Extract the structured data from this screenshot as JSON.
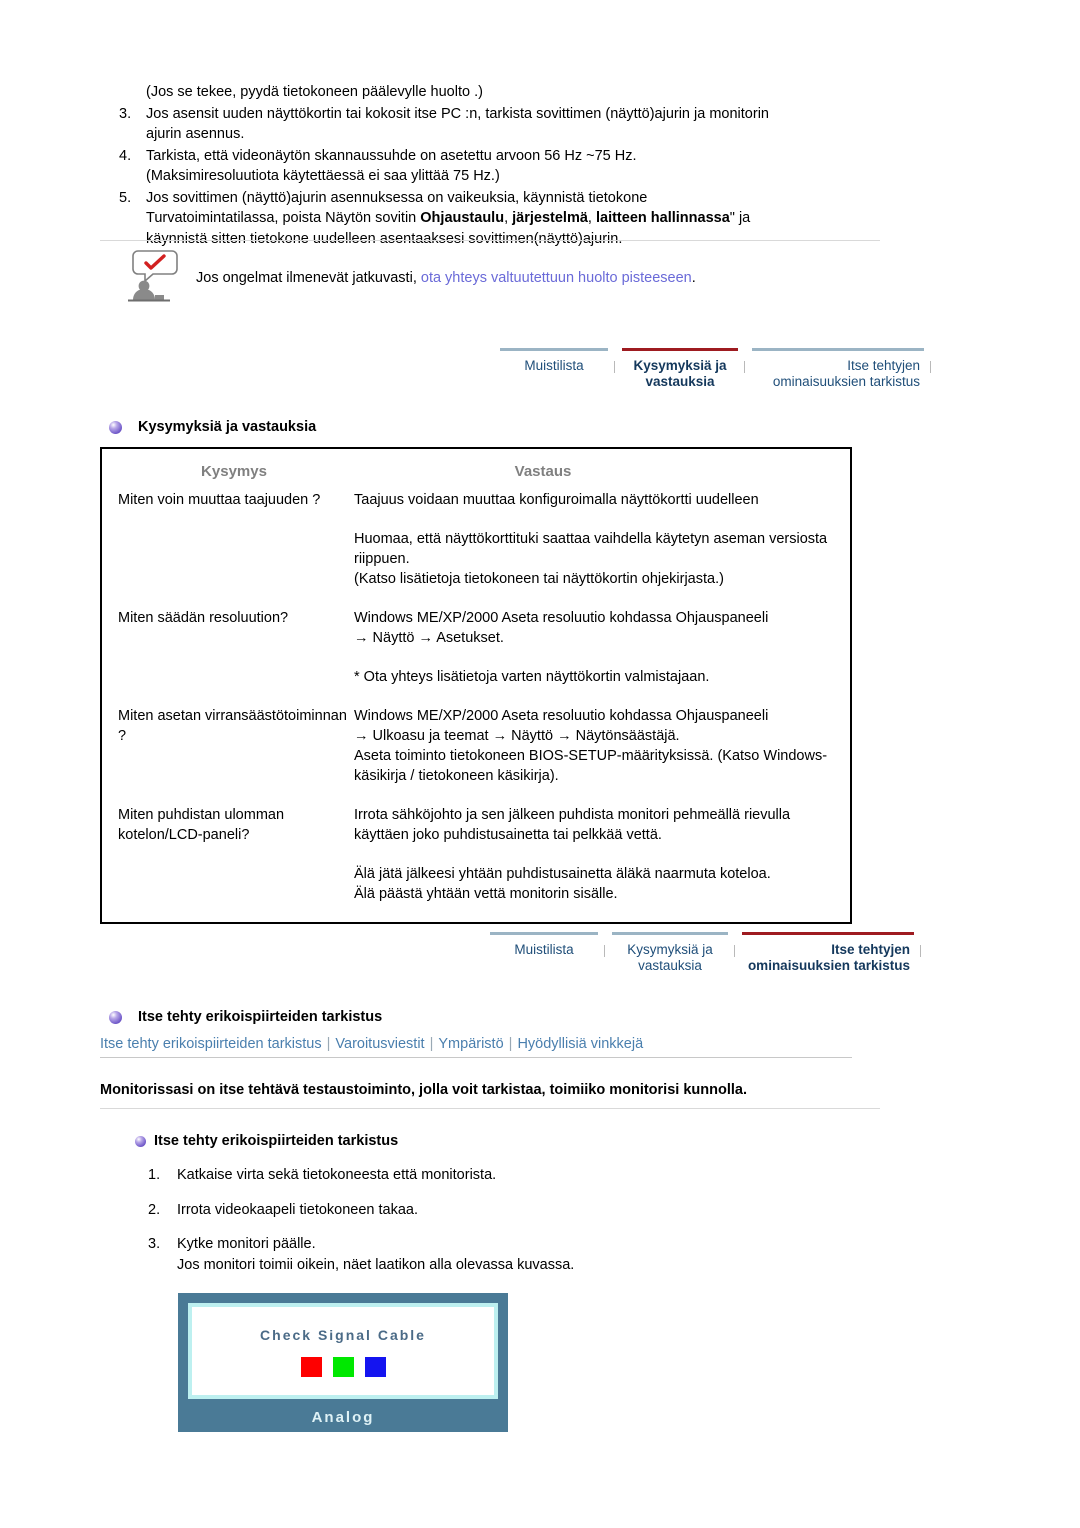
{
  "troubleshooting": {
    "intro_line": "(Jos se tekee, pyydä tietokoneen päälevylle huolto .)",
    "items": [
      {
        "num": "3.",
        "line1": "Jos asensit uuden näyttökortin tai kokosit itse PC :n, tarkista sovittimen (näyttö)ajurin ja monitorin",
        "line2": "ajurin asennus."
      },
      {
        "num": "4.",
        "line1": "Tarkista, että videonäytön skannaussuhde on asetettu arvoon 56 Hz ~75 Hz.",
        "line2": "(Maksimiresoluutiota käytettäessä ei saa ylittää 75 Hz.)"
      },
      {
        "num": "5.",
        "line1": "Jos sovittimen (näyttö)ajurin asennuksessa on vaikeuksia, käynnistä tietokone",
        "line2_pre": "Turvatoimintatilassa, poista Näytön sovitin ",
        "line2_b1": "Ohjaustaulu",
        "line2_mid1": ", ",
        "line2_b2": "järjestelmä",
        "line2_mid2": ", ",
        "line2_b3": "laitteen hallinnassa",
        "line2_post": "\" ja",
        "line3": "käynnistä sitten tietokone uudelleen asentaaksesi sovittimen(näyttö)ajurin."
      }
    ]
  },
  "note": {
    "icon": "person-with-checkmark-bubble-icon",
    "text_before": "Jos ongelmat ilmenevät jatkuvasti",
    "comma": ", ",
    "link_text": "ota yhteys valtuutettuun huolto pisteeseen",
    "text_after": ".",
    "link_color": "#6a6ad8"
  },
  "tabbar_top": {
    "tabs": [
      {
        "label": "Muistilista",
        "active": false
      },
      {
        "label": "Kysymyksiä ja vastauksia",
        "active": true
      },
      {
        "label": "Itse tehtyjen ominaisuuksien tarkistus",
        "active": false
      }
    ],
    "active_border_color": "#9e1b20",
    "inactive_border_color": "#9bb4c4"
  },
  "tabbar_bottom": {
    "tabs": [
      {
        "label": "Muistilista",
        "active": false
      },
      {
        "label": "Kysymyksiä ja vastauksia",
        "active": false
      },
      {
        "label": "Itse tehtyjen ominaisuuksien tarkistus",
        "active": true
      }
    ]
  },
  "qa_section": {
    "heading": "Kysymyksiä ja vastauksia",
    "bullet_icon": "purple-sphere-bullet-icon",
    "col_question": "Kysymys",
    "col_answer": "Vastaus",
    "header_color": "#808080",
    "rows": [
      {
        "question": "Miten voin muuttaa taajuuden ?",
        "answer_paras": [
          "Taajuus voidaan muuttaa konfiguroimalla näyttökortti uudelleen",
          "Huomaa, että näyttökorttituki saattaa vaihdella käytetyn aseman versiosta riippuen.\n(Katso lisätietoja tietokoneen tai näyttökortin ohjekirjasta.)"
        ]
      },
      {
        "question": "Miten säädän resoluution?",
        "answer_paras": [
          "Windows ME/XP/2000 Aseta resoluutio kohdassa Ohjauspaneeli\n→ Näyttö → Asetukset.",
          "* Ota yhteys lisätietoja varten näyttökortin valmistajaan."
        ]
      },
      {
        "question": "Miten asetan virransäästötoiminnan ?",
        "answer_paras": [
          "Windows ME/XP/2000 Aseta resoluutio kohdassa Ohjauspaneeli\n→ Ulkoasu ja teemat → Näyttö → Näytönsäästäjä.\nAseta toiminto tietokoneen BIOS-SETUP-määrityksissä. (Katso Windows-käsikirja / tietokoneen käsikirja)."
        ]
      },
      {
        "question": "Miten puhdistan ulomman kotelon/LCD-paneli?",
        "answer_paras": [
          "Irrota sähköjohto ja sen jälkeen puhdista monitori pehmeällä rievulla käyttäen joko puhdistusainetta tai pelkkää vettä.",
          "Älä jätä jälkeesi yhtään puhdistusainetta äläkä naarmuta koteloa.\nÄlä päästä yhtään vettä monitorin sisälle."
        ]
      }
    ]
  },
  "selftest_section": {
    "heading": "Itse tehty erikoispiirteiden tarkistus",
    "bullet_icon": "purple-sphere-bullet-icon",
    "subnav": [
      "Itse tehty erikoispiirteiden tarkistus",
      "Varoitusviestit",
      "Ympäristö",
      "Hyödyllisiä vinkkejä"
    ],
    "subnav_separator": "|",
    "subnav_color": "#4a7fae",
    "lead_text": "Monitorissasi on itse tehtävä testaustoiminto, jolla voit tarkistaa, toimiiko monitorisi kunnolla.",
    "sub_heading": "Itse tehty erikoispiirteiden tarkistus",
    "steps": [
      {
        "num": "1.",
        "lines": [
          "Katkaise virta sekä tietokoneesta että monitorista."
        ]
      },
      {
        "num": "2.",
        "lines": [
          "Irrota videokaapeli tietokoneen takaa."
        ]
      },
      {
        "num": "3.",
        "lines": [
          "Kytke monitori päälle.",
          "Jos monitori toimii oikein, näet laatikon alla olevassa kuvassa."
        ]
      }
    ]
  },
  "monitor_test": {
    "message": "Check Signal Cable",
    "label": "Analog",
    "frame_color": "#4a7a96",
    "inner_border_color": "#bdf0f0",
    "swatches": [
      {
        "name": "red-swatch",
        "color": "#fe0000"
      },
      {
        "name": "green-swatch",
        "color": "#00e800"
      },
      {
        "name": "blue-swatch",
        "color": "#1414f0"
      }
    ]
  }
}
